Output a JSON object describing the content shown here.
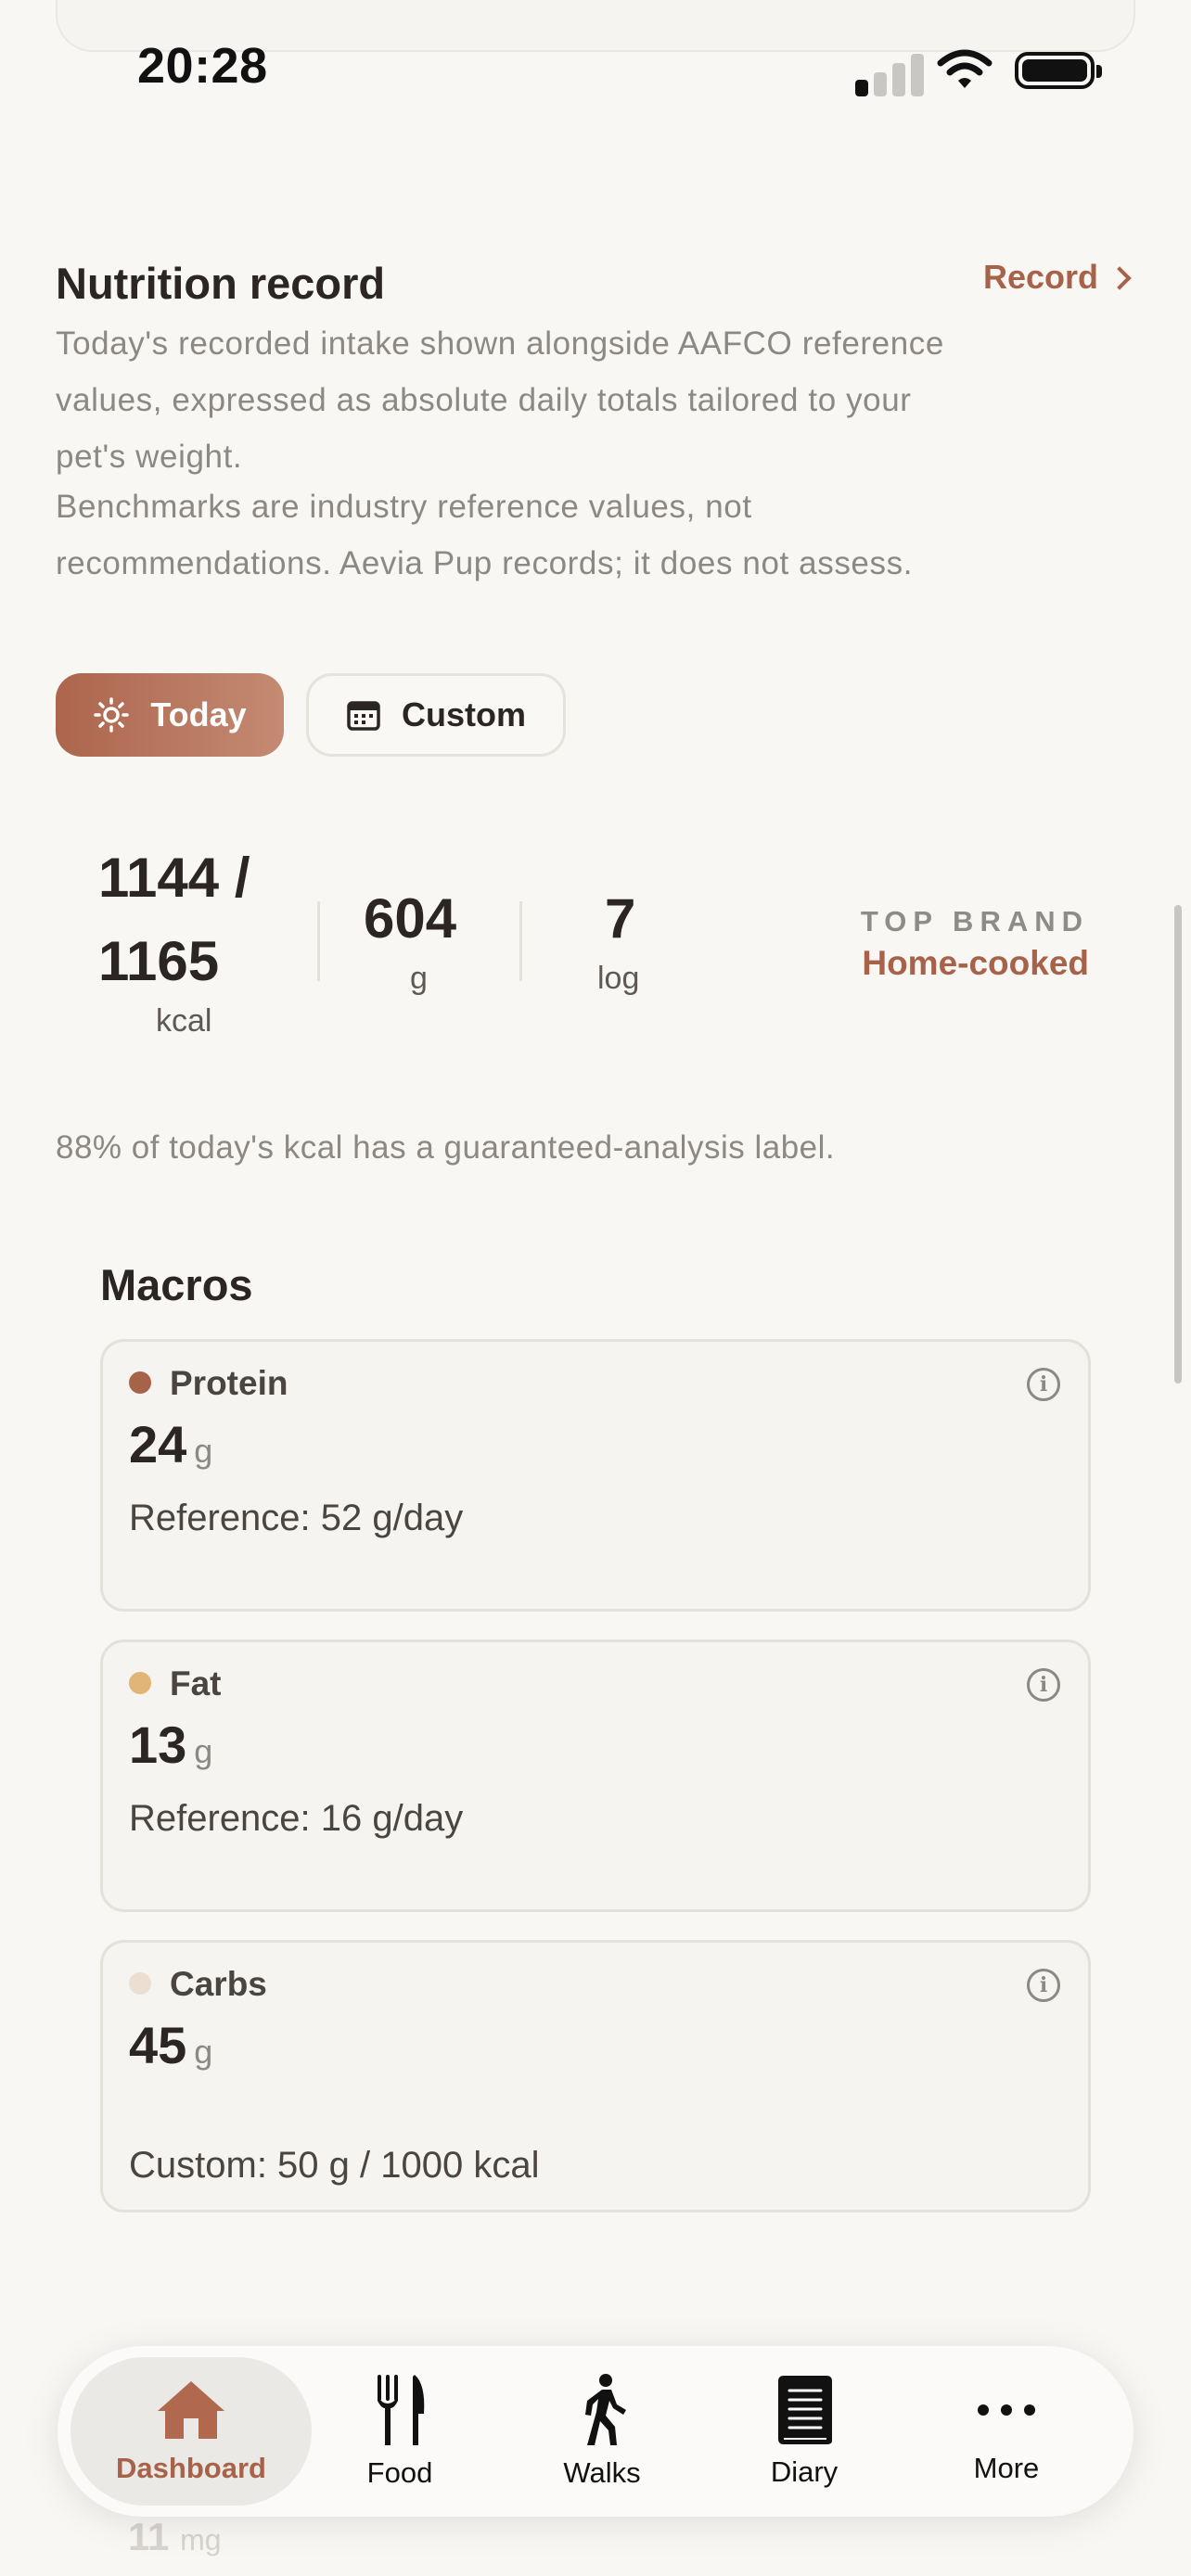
{
  "status_bar": {
    "time": "20:28"
  },
  "section": {
    "title": "Nutrition record",
    "record_link": "Record",
    "description": "Today's recorded intake shown alongside AAFCO reference values, expressed as absolute daily totals tailored to your pet's weight.",
    "disclaimer": "Benchmarks are industry reference values, not recommendations. Aevia Pup records; it does not assess."
  },
  "filters": {
    "today_label": "Today",
    "custom_label": "Custom",
    "selected": "Today"
  },
  "stats": {
    "kcal_value_line1": "1144 /",
    "kcal_value_line2": "1165",
    "kcal_unit": "kcal",
    "grams_value": "604",
    "grams_unit": "g",
    "log_value": "7",
    "log_unit": "log",
    "top_brand_label": "TOP BRAND",
    "top_brand_value": "Home-cooked"
  },
  "label_note": "88% of today's kcal has a guaranteed-analysis label.",
  "macros": {
    "title": "Macros",
    "items": [
      {
        "name": "Protein",
        "value": "24",
        "unit": "g",
        "reference": "Reference: 52 g/day",
        "color": "#a7624a"
      },
      {
        "name": "Fat",
        "value": "13",
        "unit": "g",
        "reference": "Reference: 16 g/day",
        "color": "#e1b577"
      },
      {
        "name": "Carbs",
        "value": "45",
        "unit": "g",
        "reference": "Custom: 50 g / 1000 kcal",
        "color": "#ecdfd2"
      }
    ]
  },
  "behind_tabbar": {
    "value": "11",
    "unit": "mg"
  },
  "tabbar": {
    "items": [
      {
        "label": "Dashboard",
        "icon": "home-icon"
      },
      {
        "label": "Food",
        "icon": "fork-knife-icon"
      },
      {
        "label": "Walks",
        "icon": "walking-icon"
      },
      {
        "label": "Diary",
        "icon": "notebook-icon"
      },
      {
        "label": "More",
        "icon": "ellipsis-icon"
      }
    ],
    "active": "Dashboard"
  },
  "colors": {
    "accent": "#a7624a",
    "background": "#f8f7f4"
  }
}
